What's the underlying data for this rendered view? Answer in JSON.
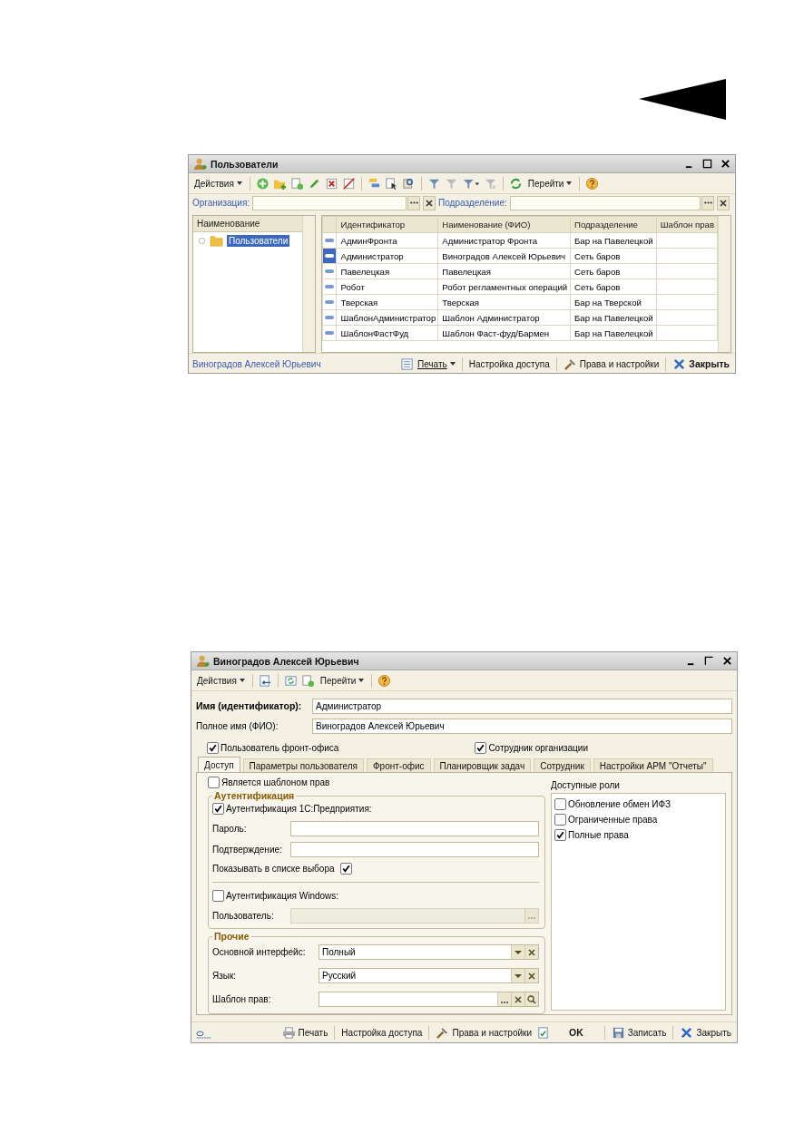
{
  "users_window": {
    "title": "Пользователи",
    "toolbar": {
      "actions": "Действия",
      "goto": "Перейти"
    },
    "filters": [
      {
        "label": "Организация:"
      },
      {
        "label": "Подразделение:"
      }
    ],
    "tree": {
      "column": "Наименование",
      "items": [
        {
          "label": "Пользователи",
          "selected": true
        }
      ]
    },
    "table": {
      "columns": [
        "Идентификатор",
        "Наименование (ФИО)",
        "Подразделение",
        "Шаблон прав"
      ],
      "rows": [
        {
          "cells": [
            "АдминФронта",
            "Администратор Фронта",
            "Бар на Павелецкой"
          ],
          "selected": false
        },
        {
          "cells": [
            "Администратор",
            "Виноградов Алексей Юрьевич",
            "Сеть баров"
          ],
          "selected": true
        },
        {
          "cells": [
            "Павелецкая",
            "Павелецкая",
            "Сеть баров"
          ],
          "selected": false
        },
        {
          "cells": [
            "Робот",
            "Робот регламентных операций",
            "Сеть баров"
          ],
          "selected": false
        },
        {
          "cells": [
            "Тверская",
            "Тверская",
            "Бар на Тверской"
          ],
          "selected": false
        },
        {
          "cells": [
            "ШаблонАдминистратор",
            "Шаблон Администратор",
            "Бар на Павелецкой"
          ],
          "selected": false
        },
        {
          "cells": [
            "ШаблонФастФуд",
            "Шаблон Фаст-фуд/Бармен",
            "Бар на Павелецкой"
          ],
          "selected": false
        }
      ]
    },
    "current_user": "Виноградов Алексей Юрьевич",
    "footer": [
      {
        "kind": "report",
        "label": "Печать"
      },
      {
        "kind": "plain",
        "label": "Настройка доступа"
      },
      {
        "kind": "tools",
        "label": "Права и настройки"
      },
      {
        "kind": "close",
        "label": "Закрыть"
      }
    ]
  },
  "user_window": {
    "title": "Виноградов Алексей Юрьевич",
    "toolbar": {
      "actions": "Действия",
      "goto": "Перейти"
    },
    "fields": [
      {
        "label": "Имя (идентификатор):",
        "value": "Администратор"
      },
      {
        "label": "Полное имя (ФИО):",
        "value": "Виноградов Алексей Юрьевич"
      }
    ],
    "flags": [
      {
        "label": "Пользователь фронт-офиса",
        "checked": true
      },
      {
        "label": "Сотрудник организации",
        "checked": true
      }
    ],
    "tabs": [
      {
        "label": "Доступ",
        "selected": true
      },
      {
        "label": "Параметры пользователя",
        "selected": false
      },
      {
        "label": "Фронт-офис",
        "selected": false
      },
      {
        "label": "Планировщик задач",
        "selected": false
      },
      {
        "label": "Сотрудник",
        "selected": false
      },
      {
        "label": "Настройки АРМ \"Отчеты\"",
        "selected": false
      }
    ],
    "is_template": {
      "label": "Является шаблоном прав",
      "checked": false
    },
    "auth": {
      "title": "Аутентификация",
      "enterprise": {
        "label": "Аутентификация 1С:Предприятия:",
        "checked": true
      },
      "password": {
        "label": "Пароль:"
      },
      "confirm": {
        "label": "Подтверждение:"
      },
      "show_in_list": {
        "label": "Показывать в списке выбора",
        "checked": true
      },
      "windows": {
        "label": "Аутентификация Windows:",
        "checked": false
      },
      "windows_user": {
        "label": "Пользователь:",
        "disabled": true
      }
    },
    "other": {
      "title": "Прочие",
      "fields": [
        {
          "kind": "choice",
          "label": "Основной интерфейс:",
          "value": "Полный"
        },
        {
          "kind": "choice",
          "label": "Язык:",
          "value": "Русский"
        },
        {
          "kind": "lookup",
          "label": "Шаблон прав:"
        }
      ]
    },
    "roles": {
      "title": "Доступные роли",
      "items": [
        {
          "label": "Обновление обмен ИФЗ",
          "checked": false
        },
        {
          "label": "Ограниченные права",
          "checked": false
        },
        {
          "label": "Полные права",
          "checked": true
        }
      ]
    },
    "footer": [
      {
        "kind": "print",
        "label": "Печать"
      },
      {
        "kind": "plain",
        "label": "Настройка доступа"
      },
      {
        "kind": "tools",
        "label": "Права и настройки"
      },
      {
        "kind": "ok",
        "label": "OK"
      },
      {
        "kind": "save",
        "label": "Записать"
      },
      {
        "kind": "close",
        "label": "Закрыть"
      }
    ]
  }
}
